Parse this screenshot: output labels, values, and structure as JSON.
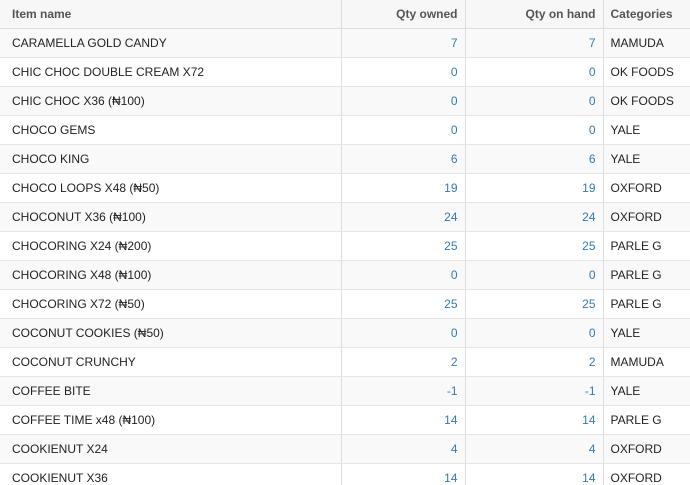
{
  "table": {
    "headers": {
      "name": "Item name",
      "owned": "Qty owned",
      "on_hand": "Qty on hand",
      "categories": "Categories"
    },
    "rows": [
      {
        "name": "CARAMELLA GOLD CANDY",
        "owned": "7",
        "on_hand": "7",
        "category": "MAMUDA"
      },
      {
        "name": "CHIC CHOC DOUBLE CREAM X72",
        "owned": "0",
        "on_hand": "0",
        "category": "OK FOODS"
      },
      {
        "name": "CHIC CHOC X36 (₦100)",
        "owned": "0",
        "on_hand": "0",
        "category": "OK FOODS"
      },
      {
        "name": "CHOCO GEMS",
        "owned": "0",
        "on_hand": "0",
        "category": "YALE"
      },
      {
        "name": "CHOCO KING",
        "owned": "6",
        "on_hand": "6",
        "category": "YALE"
      },
      {
        "name": "CHOCO LOOPS X48 (₦50)",
        "owned": "19",
        "on_hand": "19",
        "category": "OXFORD"
      },
      {
        "name": "CHOCONUT X36 (₦100)",
        "owned": "24",
        "on_hand": "24",
        "category": "OXFORD"
      },
      {
        "name": "CHOCORING X24 (₦200)",
        "owned": "25",
        "on_hand": "25",
        "category": "PARLE G"
      },
      {
        "name": "CHOCORING X48 (₦100)",
        "owned": "0",
        "on_hand": "0",
        "category": "PARLE G"
      },
      {
        "name": "CHOCORING X72 (₦50)",
        "owned": "25",
        "on_hand": "25",
        "category": "PARLE G"
      },
      {
        "name": "COCONUT COOKIES (₦50)",
        "owned": "0",
        "on_hand": "0",
        "category": "YALE"
      },
      {
        "name": "COCONUT CRUNCHY",
        "owned": "2",
        "on_hand": "2",
        "category": "MAMUDA"
      },
      {
        "name": "COFFEE BITE",
        "owned": "-1",
        "on_hand": "-1",
        "category": "YALE"
      },
      {
        "name": "COFFEE TIME x48 (₦100)",
        "owned": "14",
        "on_hand": "14",
        "category": "PARLE G"
      },
      {
        "name": "COOKIENUT X24",
        "owned": "4",
        "on_hand": "4",
        "category": "OXFORD"
      },
      {
        "name": "COOKIENUT X36",
        "owned": "14",
        "on_hand": "14",
        "category": "OXFORD"
      }
    ]
  }
}
